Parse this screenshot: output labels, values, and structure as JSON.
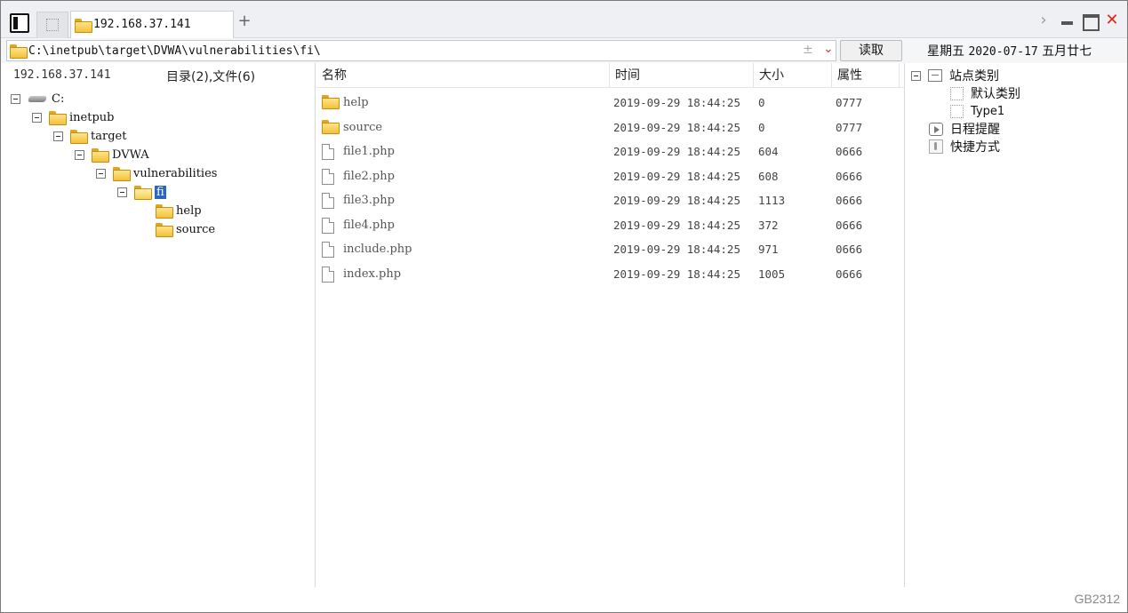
{
  "tabs": [
    {
      "label": "192.168.37.141",
      "active": true
    }
  ],
  "tab_add_label": "+",
  "window_controls": {
    "chevron": "›",
    "close": "✕"
  },
  "address_bar": {
    "path": "C:\\inetpub\\target\\DVWA\\vulnerabilities\\fi\\",
    "plus_minus": "±",
    "dropdown": "⌄",
    "read_button": "读取"
  },
  "datetime": {
    "weekday": "星期五",
    "date": "2020-07-17",
    "lunar": "五月廿七"
  },
  "left_panel": {
    "host": "192.168.37.141",
    "summary": "目录(2),文件(6)",
    "tree": [
      {
        "label": "C:",
        "type": "drive",
        "level": 0,
        "expanded": true
      },
      {
        "label": "inetpub",
        "type": "folder",
        "level": 1,
        "expanded": true
      },
      {
        "label": "target",
        "type": "folder",
        "level": 2,
        "expanded": true
      },
      {
        "label": "DVWA",
        "type": "folder",
        "level": 3,
        "expanded": true
      },
      {
        "label": "vulnerabilities",
        "type": "folder",
        "level": 4,
        "expanded": true
      },
      {
        "label": "fi",
        "type": "folder",
        "level": 5,
        "expanded": true,
        "selected": true
      },
      {
        "label": "help",
        "type": "folder",
        "level": 6
      },
      {
        "label": "source",
        "type": "folder",
        "level": 6
      }
    ]
  },
  "file_list": {
    "columns": {
      "name": "名称",
      "time": "时间",
      "size": "大小",
      "attr": "属性"
    },
    "rows": [
      {
        "name": "help",
        "type": "folder",
        "time": "2019-09-29 18:44:25",
        "size": "0",
        "attr": "0777"
      },
      {
        "name": "source",
        "type": "folder",
        "time": "2019-09-29 18:44:25",
        "size": "0",
        "attr": "0777"
      },
      {
        "name": "file1.php",
        "type": "file",
        "time": "2019-09-29 18:44:25",
        "size": "604",
        "attr": "0666"
      },
      {
        "name": "file2.php",
        "type": "file",
        "time": "2019-09-29 18:44:25",
        "size": "608",
        "attr": "0666"
      },
      {
        "name": "file3.php",
        "type": "file",
        "time": "2019-09-29 18:44:25",
        "size": "1113",
        "attr": "0666"
      },
      {
        "name": "file4.php",
        "type": "file",
        "time": "2019-09-29 18:44:25",
        "size": "372",
        "attr": "0666"
      },
      {
        "name": "include.php",
        "type": "file",
        "time": "2019-09-29 18:44:25",
        "size": "971",
        "attr": "0666"
      },
      {
        "name": "index.php",
        "type": "file",
        "time": "2019-09-29 18:44:25",
        "size": "1005",
        "attr": "0666"
      }
    ]
  },
  "right_panel": {
    "site_category": "站点类别",
    "categories": [
      "默认类别",
      "Type1"
    ],
    "schedule": "日程提醒",
    "shortcuts": "快捷方式"
  },
  "status_bar": {
    "encoding": "GB2312"
  },
  "colors": {
    "selection": "#2b66c4",
    "close": "#e2231a",
    "folder": "#f3c13a"
  }
}
